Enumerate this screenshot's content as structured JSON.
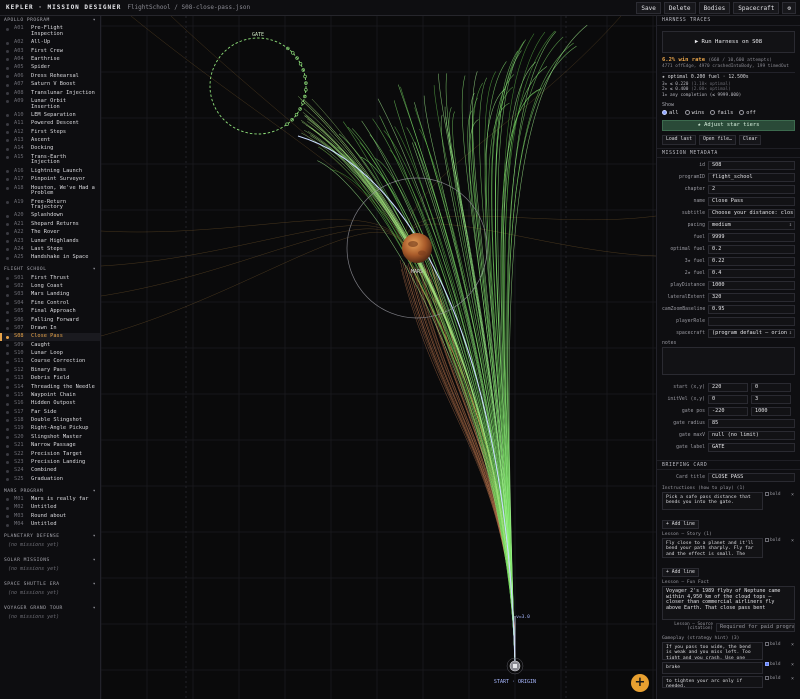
{
  "topbar": {
    "brand": "KEPLER · MISSION DESIGNER",
    "breadcrumb": "FlightSchool / S08-close-pass.json",
    "buttons": [
      "Save",
      "Delete",
      "Bodies",
      "Spacecraft"
    ],
    "gear_icon": "⚙"
  },
  "sidebar": {
    "groups": [
      {
        "title": "APOLLO PROGRAM",
        "items": [
          {
            "code": "A01",
            "label": "Pre-Flight Inspection"
          },
          {
            "code": "A02",
            "label": "All-Up"
          },
          {
            "code": "A03",
            "label": "First Crew"
          },
          {
            "code": "A04",
            "label": "Earthrise"
          },
          {
            "code": "A05",
            "label": "Spider"
          },
          {
            "code": "A06",
            "label": "Dress Rehearsal"
          },
          {
            "code": "A07",
            "label": "Saturn V Boost"
          },
          {
            "code": "A08",
            "label": "Translunar Injection"
          },
          {
            "code": "A09",
            "label": "Lunar Orbit Insertion"
          },
          {
            "code": "A10",
            "label": "LEM Separation"
          },
          {
            "code": "A11",
            "label": "Powered Descent"
          },
          {
            "code": "A12",
            "label": "First Steps"
          },
          {
            "code": "A13",
            "label": "Ascent"
          },
          {
            "code": "A14",
            "label": "Docking"
          },
          {
            "code": "A15",
            "label": "Trans-Earth Injection"
          },
          {
            "code": "A16",
            "label": "Lightning Launch"
          },
          {
            "code": "A17",
            "label": "Pinpoint Surveyor"
          },
          {
            "code": "A18",
            "label": "Houston, We've Had a Problem"
          },
          {
            "code": "A19",
            "label": "Free-Return Trajectory"
          },
          {
            "code": "A20",
            "label": "Splashdown"
          },
          {
            "code": "A21",
            "label": "Shepard Returns"
          },
          {
            "code": "A22",
            "label": "The Rover"
          },
          {
            "code": "A23",
            "label": "Lunar Highlands"
          },
          {
            "code": "A24",
            "label": "Last Steps"
          },
          {
            "code": "A25",
            "label": "Handshake in Space"
          }
        ]
      },
      {
        "title": "FLIGHT SCHOOL",
        "items": [
          {
            "code": "S01",
            "label": "First Thrust"
          },
          {
            "code": "S02",
            "label": "Long Coast"
          },
          {
            "code": "S03",
            "label": "Mars Landing"
          },
          {
            "code": "S04",
            "label": "Fine Control"
          },
          {
            "code": "S05",
            "label": "Final Approach"
          },
          {
            "code": "S06",
            "label": "Falling Forward"
          },
          {
            "code": "S07",
            "label": "Drawn In"
          },
          {
            "code": "S08",
            "label": "Close Pass",
            "selected": true
          },
          {
            "code": "S09",
            "label": "Caught"
          },
          {
            "code": "S10",
            "label": "Lunar Loop"
          },
          {
            "code": "S11",
            "label": "Course Correction"
          },
          {
            "code": "S12",
            "label": "Binary Pass"
          },
          {
            "code": "S13",
            "label": "Debris Field"
          },
          {
            "code": "S14",
            "label": "Threading the Needle"
          },
          {
            "code": "S15",
            "label": "Waypoint Chain"
          },
          {
            "code": "S16",
            "label": "Hidden Outpost"
          },
          {
            "code": "S17",
            "label": "Far Side"
          },
          {
            "code": "S18",
            "label": "Double Slingshot"
          },
          {
            "code": "S19",
            "label": "Right-Angle Pickup"
          },
          {
            "code": "S20",
            "label": "Slingshot Master"
          },
          {
            "code": "S21",
            "label": "Narrow Passage"
          },
          {
            "code": "S22",
            "label": "Precision Target"
          },
          {
            "code": "S23",
            "label": "Precision Landing"
          },
          {
            "code": "S24",
            "label": "Combined"
          },
          {
            "code": "S25",
            "label": "Graduation"
          }
        ]
      },
      {
        "title": "MARS PROGRAM",
        "items": [
          {
            "code": "M01",
            "label": "Mars is really far"
          },
          {
            "code": "M02",
            "label": "Untitled"
          },
          {
            "code": "M03",
            "label": "Round about"
          },
          {
            "code": "M04",
            "label": "Untitled"
          }
        ]
      },
      {
        "title": "PLANETARY DEFENSE",
        "empty": "(no missions yet)",
        "items": []
      },
      {
        "title": "SOLAR MISSIONS",
        "empty": "(no missions yet)",
        "items": []
      },
      {
        "title": "SPACE SHUTTLE ERA",
        "empty": "(no missions yet)",
        "items": []
      },
      {
        "title": "VOYAGER GRAND TOUR",
        "empty": "(no missions yet)",
        "items": []
      }
    ]
  },
  "canvas": {
    "gate_label": "GATE",
    "planet_label": "MARS",
    "start_label": "START · ORIGIN",
    "velocity_label": "v=3.0",
    "colors": {
      "green_traces": "#9fdc7a",
      "fail_traces": "#e08a5a",
      "gate": "#8ee07a",
      "path": "#c8dcff"
    }
  },
  "fab": {
    "icon": "+"
  },
  "panel": {
    "harness_title": "HARNESS TRACES",
    "run_label": "▶  Run Harness on S08",
    "win_rate_prefix": "6.2% win rate",
    "win_rate_detail": "(668 / 10,600 attempts)",
    "fail_detail": "4771 offEdge, 4970 crashedIntoBody, 199 timedOut",
    "optimal_line": "★ optimal 0.200 fuel · 12.500s",
    "tiers": [
      {
        "star": "3★",
        "text": "≤ 0.220",
        "muted": "(1.10× optimal)"
      },
      {
        "star": "2★",
        "text": "≤ 0.400",
        "muted": "(2.00× optimal)"
      },
      {
        "star": "1★",
        "text": "any completion (≤ 9999.000)",
        "muted": ""
      }
    ],
    "show_label": "Show",
    "show_options": [
      "all",
      "wins",
      "fails",
      "off"
    ],
    "adjust_label": "★ Adjust star tiers",
    "mini_buttons": [
      "Load last",
      "Open file…",
      "Clear"
    ],
    "meta_title": "MISSION METADATA",
    "fields": [
      {
        "label": "id",
        "value": "S08"
      },
      {
        "label": "programID",
        "value": "flight_school"
      },
      {
        "label": "chapter",
        "value": "2"
      },
      {
        "label": "name",
        "value": "Close Pass"
      },
      {
        "label": "subtitle",
        "value": "Choose your distance: clos"
      },
      {
        "label": "pacing",
        "value": "medium",
        "select": true
      },
      {
        "label": "fuel",
        "value": "9999"
      },
      {
        "label": "optimal fuel",
        "value": "0.2"
      },
      {
        "label": "3★ fuel",
        "value": "0.22"
      },
      {
        "label": "2★ fuel",
        "value": "0.4"
      },
      {
        "label": "playDistance",
        "value": "1000"
      },
      {
        "label": "lateralExtent",
        "value": "320"
      },
      {
        "label": "camZoomBaseline",
        "value": "0.95"
      },
      {
        "label": "playerRole",
        "value": ""
      },
      {
        "label": "spacecraft",
        "value": "(program default — orion",
        "select": true
      }
    ],
    "notes_label": "notes",
    "vec_fields": [
      {
        "label": "start (x,y)",
        "a": "220",
        "b": "0"
      },
      {
        "label": "initVel (x,y)",
        "a": "0",
        "b": "3"
      },
      {
        "label": "gate pos",
        "a": "-220",
        "b": "1000"
      }
    ],
    "gate_fields": [
      {
        "label": "gate radius",
        "value": "85"
      },
      {
        "label": "gate maxV",
        "value": "null (no limit)"
      },
      {
        "label": "gate label",
        "value": "GATE"
      }
    ],
    "briefing_title": "BRIEFING CARD",
    "card_title_label": "Card title",
    "card_title_value": "CLOSE PASS",
    "instructions_head": "Instructions (how to play) (1)",
    "instructions_line": "Pick a safe pass distance that bends you into the gate.",
    "add_line": "+ Add line",
    "story_head": "Lesson — Story (1)",
    "story_line": "Fly close to a planet and it'll bend your path sharply. Fly far and the effect is small. The",
    "funfact_head": "Lesson — Fun Fact",
    "funfact_text": "Voyager 2's 1989 flyby of Neptune came within 4,950 km of the cloud tops — closer than commercial airliners fly above Earth. That close pass bent",
    "source_head": "Lesson — Source (citation)",
    "source_value": "Required for paid programs",
    "hint_head": "Gameplay (strategy hint) (3)",
    "hint_lines": [
      {
        "text": "If you pass too wide, the bend is weak and you miss left. Too tight and you crash. Use one short",
        "bold": false
      },
      {
        "text": "brake",
        "bold": true
      },
      {
        "text": "to tighten your arc only if needed.",
        "bold": false
      }
    ],
    "bold_label": "bold",
    "remove_icon": "×"
  }
}
